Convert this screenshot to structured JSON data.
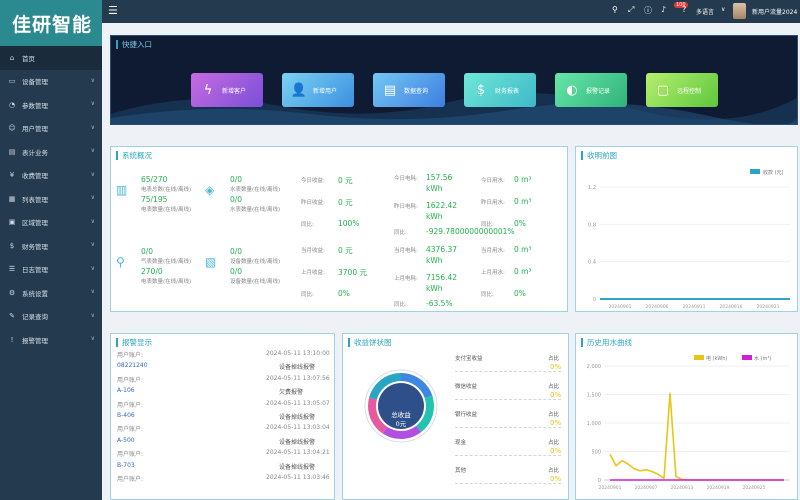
{
  "logo": "佳研智能",
  "menu": [
    {
      "icon": "home-icon",
      "glyph": "⌂",
      "label": "首页",
      "active": true,
      "arrow": false
    },
    {
      "icon": "monitor-icon",
      "glyph": "▭",
      "label": "设备管理",
      "arrow": true
    },
    {
      "icon": "gauge-icon",
      "glyph": "◔",
      "label": "参数管理",
      "arrow": true
    },
    {
      "icon": "user-icon",
      "glyph": "☺",
      "label": "用户管理",
      "arrow": true
    },
    {
      "icon": "bill-icon",
      "glyph": "▤",
      "label": "表计业务",
      "arrow": true
    },
    {
      "icon": "charge-icon",
      "glyph": "¥",
      "label": "收费管理",
      "arrow": true
    },
    {
      "icon": "report-icon",
      "glyph": "▦",
      "label": "列表管理",
      "arrow": true
    },
    {
      "icon": "area-icon",
      "glyph": "▣",
      "label": "区域管理",
      "arrow": true
    },
    {
      "icon": "finance-icon",
      "glyph": "$",
      "label": "财务管理",
      "arrow": true
    },
    {
      "icon": "log-icon",
      "glyph": "☰",
      "label": "日志管理",
      "arrow": true
    },
    {
      "icon": "settings-icon",
      "glyph": "⚙",
      "label": "系统设置",
      "arrow": true
    },
    {
      "icon": "record-icon",
      "glyph": "✎",
      "label": "记录查询",
      "arrow": true
    },
    {
      "icon": "alarm-icon",
      "glyph": "!",
      "label": "报警管理",
      "arrow": true
    }
  ],
  "topbar": {
    "badge": "100",
    "lang": "多语言",
    "user": "新用户流量2024"
  },
  "quick": {
    "title": "快捷入口",
    "buttons": [
      {
        "label": "新增客户",
        "glyph": "ϟ",
        "c1": "#c76be0",
        "c2": "#7b4fd8",
        "icon": "power-icon"
      },
      {
        "label": "新增用户",
        "glyph": "👤",
        "c1": "#7ad3f3",
        "c2": "#3c8fe0",
        "icon": "add-user-icon"
      },
      {
        "label": "数据查询",
        "glyph": "▤",
        "c1": "#74c8f5",
        "c2": "#3d7ee0",
        "icon": "document-icon"
      },
      {
        "label": "财务报表",
        "glyph": "$",
        "c1": "#6fe8d8",
        "c2": "#3eb8c8",
        "icon": "money-bag-icon"
      },
      {
        "label": "报警记录",
        "glyph": "◐",
        "c1": "#68e6a8",
        "c2": "#2fb37a",
        "icon": "meter-icon"
      },
      {
        "label": "远程控制",
        "glyph": "▢",
        "c1": "#b6ef6e",
        "c2": "#5dc73d",
        "icon": "screen-icon"
      }
    ]
  },
  "overview": {
    "title": "系统概况",
    "stats": [
      {
        "v1": "65/270",
        "l1": "电表总数(在线/离线)",
        "v2": "75/195",
        "l2": "电表数量(在线/离线)"
      },
      {
        "v1": "0/0",
        "l1": "水表数量(在线/离线)",
        "v2": "0/0",
        "l2": "水表数量(在线/离线)"
      },
      {
        "v1": "0/0",
        "l1": "气表数量(在线/离线)",
        "v2": "270/0",
        "l2": "电表数量(在线/离线)"
      },
      {
        "v1": "0/0",
        "l1": "设备数量(在线/离线)",
        "v2": "0/0",
        "l2": "设备数量(在线/离线)"
      }
    ],
    "colA": [
      {
        "label": "今日收益:",
        "value": "0 元"
      },
      {
        "label": "昨日收益:",
        "value": "0 元"
      },
      {
        "label": "同比:",
        "value": "100%"
      },
      {
        "label": "当月收益:",
        "value": "0 元"
      },
      {
        "label": "上月收益:",
        "value": "3700 元"
      },
      {
        "label": "同比:",
        "value": "0%"
      }
    ],
    "colB": [
      {
        "label": "今日电耗:",
        "value": "157.56"
      },
      {
        "label": "",
        "value": "kWh"
      },
      {
        "label": "昨日电耗:",
        "value": "1622.42"
      },
      {
        "label": "",
        "value": "kWh"
      },
      {
        "label": "同比:",
        "value": "-929.7800000000001%"
      },
      {
        "label": "当月电耗:",
        "value": "4376.37"
      },
      {
        "label": "",
        "value": "kWh"
      },
      {
        "label": "上月电耗:",
        "value": "7156.42"
      },
      {
        "label": "",
        "value": "kWh"
      },
      {
        "label": "同比:",
        "value": "-63.5%"
      }
    ],
    "colC": [
      {
        "label": "今日用水:",
        "value": "0 m³"
      },
      {
        "label": "昨日用水:",
        "value": "0 m³"
      },
      {
        "label": "同比:",
        "value": "0%"
      },
      {
        "label": "当月用水:",
        "value": "0 m³"
      },
      {
        "label": "上月用水:",
        "value": "0 m³"
      },
      {
        "label": "同比:",
        "value": "0%"
      }
    ]
  },
  "income": {
    "title": "收明前图",
    "legend": "收款 (元)",
    "yticks": [
      "1.2",
      "0.8",
      "0.4",
      "0"
    ],
    "xticks": [
      "20240901",
      "20240906",
      "20240911",
      "20240916",
      "20240921"
    ]
  },
  "warnings": {
    "title": "报警显示",
    "rows": [
      {
        "name": "用户账户:",
        "time": "2024-05-11 13:10:00",
        "type": ""
      },
      {
        "name": "08221240",
        "time": "",
        "type": "设备掉线报警"
      },
      {
        "name": "用户账户:",
        "time": "2024-05-11 13:07:56",
        "type": ""
      },
      {
        "name": "A-106",
        "time": "",
        "type": "欠费报警"
      },
      {
        "name": "用户账户:",
        "time": "2024-05-11 13:05:07",
        "type": ""
      },
      {
        "name": "B-406",
        "time": "",
        "type": "设备掉线报警"
      },
      {
        "name": "用户账户:",
        "time": "2024-05-11 13:03:04",
        "type": ""
      },
      {
        "name": "A-500",
        "time": "",
        "type": "设备掉线报警"
      },
      {
        "name": "用户账户:",
        "time": "2024-05-11 13:04:21",
        "type": ""
      },
      {
        "name": "B-703",
        "time": "",
        "type": "设备掉线报警"
      },
      {
        "name": "用户账户:",
        "time": "2024-05-11 13:03:46",
        "type": ""
      }
    ]
  },
  "pie": {
    "title": "收益饼状图",
    "center1": "总收益",
    "center2": "0元",
    "items": [
      {
        "label": "支付宝收益",
        "pct": "0%",
        "share_label": "占比"
      },
      {
        "label": "微信收益",
        "pct": "0%",
        "share_label": "占比"
      },
      {
        "label": "银行收益",
        "pct": "0%",
        "share_label": "占比"
      },
      {
        "label": "现金",
        "pct": "0%",
        "share_label": "占比"
      },
      {
        "label": "其他",
        "pct": "0%",
        "share_label": "占比"
      }
    ]
  },
  "chart_data": {
    "type": "line",
    "title": "历史用水曲线",
    "series": [
      {
        "name": "电 (kWh)",
        "color": "#e6c619"
      },
      {
        "name": "水 (m³)",
        "color": "#d11fd1"
      }
    ],
    "yticks": [
      0,
      500,
      1000,
      1500,
      2000
    ],
    "ylim": [
      0,
      2000
    ],
    "xticks": [
      "20240901",
      "20240907",
      "20240913",
      "20240919",
      "20240925"
    ],
    "x": [
      1,
      2,
      3,
      4,
      5,
      6,
      7,
      8,
      9,
      10,
      11,
      12,
      13,
      14,
      15,
      16,
      17,
      18,
      19,
      20,
      21,
      22,
      23,
      24,
      25,
      26,
      27,
      28,
      29,
      30
    ],
    "values": [
      [
        450,
        250,
        340,
        280,
        200,
        160,
        180,
        150,
        100,
        30,
        1520,
        60,
        10,
        0,
        0,
        0,
        0,
        0,
        0,
        0,
        0,
        0,
        0,
        0,
        0,
        0,
        0,
        0,
        0,
        0
      ],
      [
        0,
        0,
        0,
        0,
        0,
        0,
        0,
        0,
        0,
        0,
        0,
        0,
        0,
        0,
        0,
        0,
        0,
        0,
        0,
        0,
        0,
        0,
        0,
        0,
        0,
        0,
        0,
        0,
        0,
        0
      ]
    ]
  }
}
